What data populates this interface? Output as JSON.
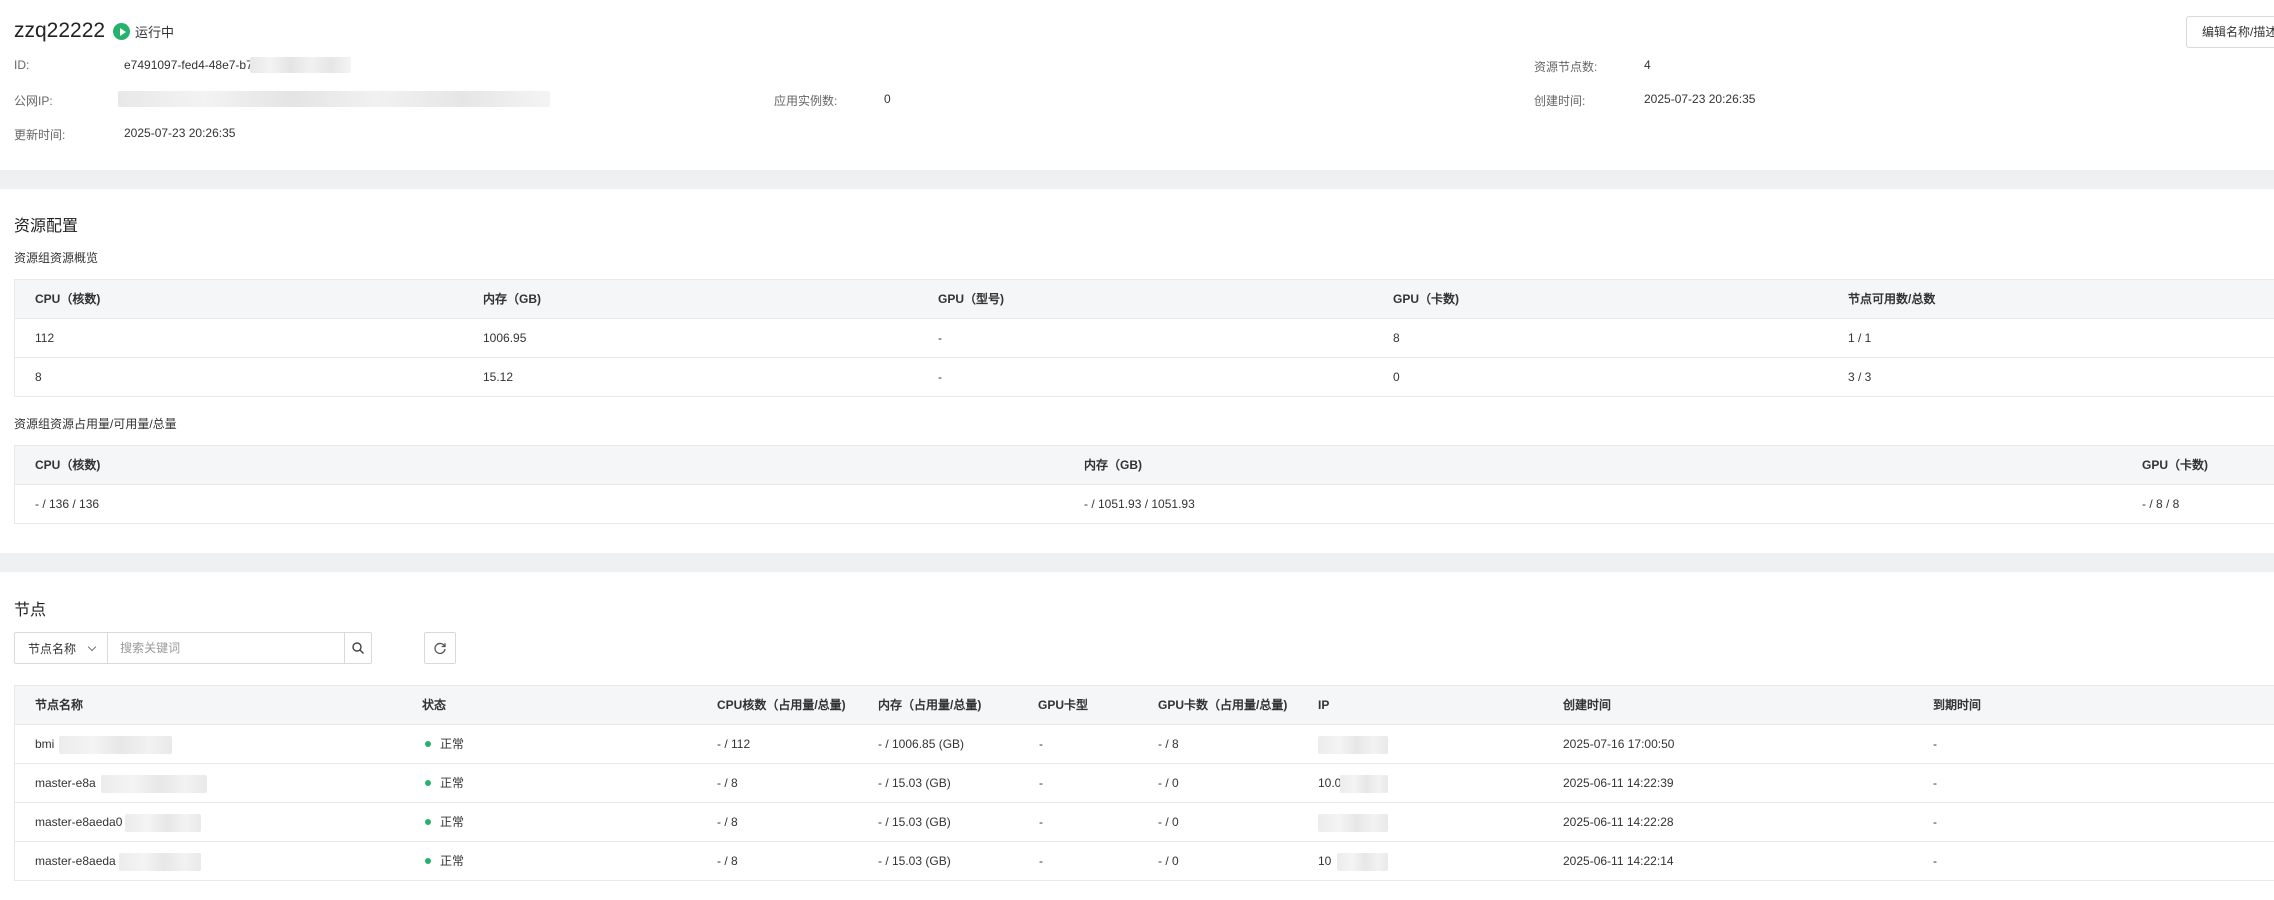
{
  "header": {
    "title": "zzq22222",
    "status": "运行中",
    "edit_button": "编辑名称/描述",
    "fields": {
      "id_label": "ID:",
      "id_value": "e7491097-fed4-48e7-b7",
      "public_ip_label": "公网IP:",
      "app_instances_label": "应用实例数:",
      "app_instances_value": "0",
      "update_time_label": "更新时间:",
      "update_time_value": "2025-07-23 20:26:35",
      "resource_nodes_label": "资源节点数:",
      "resource_nodes_value": "4",
      "created_time_label": "创建时间:",
      "created_time_value": "2025-07-23 20:26:35"
    }
  },
  "resources": {
    "title": "资源配置",
    "overview_title": "资源组资源概览",
    "overview_headers": [
      "CPU（核数)",
      "内存（GB)",
      "GPU（型号)",
      "GPU（卡数)",
      "节点可用数/总数"
    ],
    "overview_rows": [
      [
        "112",
        "1006.95",
        "-",
        "8",
        "1 / 1"
      ],
      [
        "8",
        "15.12",
        "-",
        "0",
        "3 / 3"
      ]
    ],
    "usage_title": "资源组资源占用量/可用量/总量",
    "usage_headers": [
      "CPU（核数)",
      "内存（GB)",
      "GPU（卡数)"
    ],
    "usage_rows": [
      [
        "- / 136 / 136",
        "- / 1051.93 / 1051.93",
        "- / 8 / 8"
      ]
    ]
  },
  "nodes": {
    "title": "节点",
    "filter_label": "节点名称",
    "search_placeholder": "搜索关键词",
    "headers": [
      "节点名称",
      "状态",
      "CPU核数（占用量/总量)",
      "内存（占用量/总量)",
      "GPU卡型",
      "GPU卡数（占用量/总量)",
      "IP",
      "创建时间",
      "到期时间"
    ],
    "rows": [
      {
        "name": "bmi",
        "status": "正常",
        "cpu": "- / 112",
        "mem": "- / 1006.85 (GB)",
        "gpu_type": "-",
        "gpu": "- / 8",
        "ip": "",
        "created": "2025-07-16 17:00:50",
        "expire": "-"
      },
      {
        "name": "master-e8a",
        "status": "正常",
        "cpu": "- / 8",
        "mem": "- / 15.03 (GB)",
        "gpu_type": "-",
        "gpu": "- / 0",
        "ip": "10.0",
        "created": "2025-06-11 14:22:39",
        "expire": "-"
      },
      {
        "name": "master-e8aeda0",
        "status": "正常",
        "cpu": "- / 8",
        "mem": "- / 15.03 (GB)",
        "gpu_type": "-",
        "gpu": "- / 0",
        "ip": "",
        "created": "2025-06-11 14:22:28",
        "expire": "-"
      },
      {
        "name": "master-e8aeda",
        "status": "正常",
        "cpu": "- / 8",
        "mem": "- / 15.03 (GB)",
        "gpu_type": "-",
        "gpu": "- / 0",
        "ip": "10",
        "created": "2025-06-11 14:22:14",
        "expire": "-"
      }
    ]
  },
  "colors": {
    "accent_green": "#27b26c",
    "section_gap": "#eff0f2",
    "table_head": "#f5f6f7"
  }
}
